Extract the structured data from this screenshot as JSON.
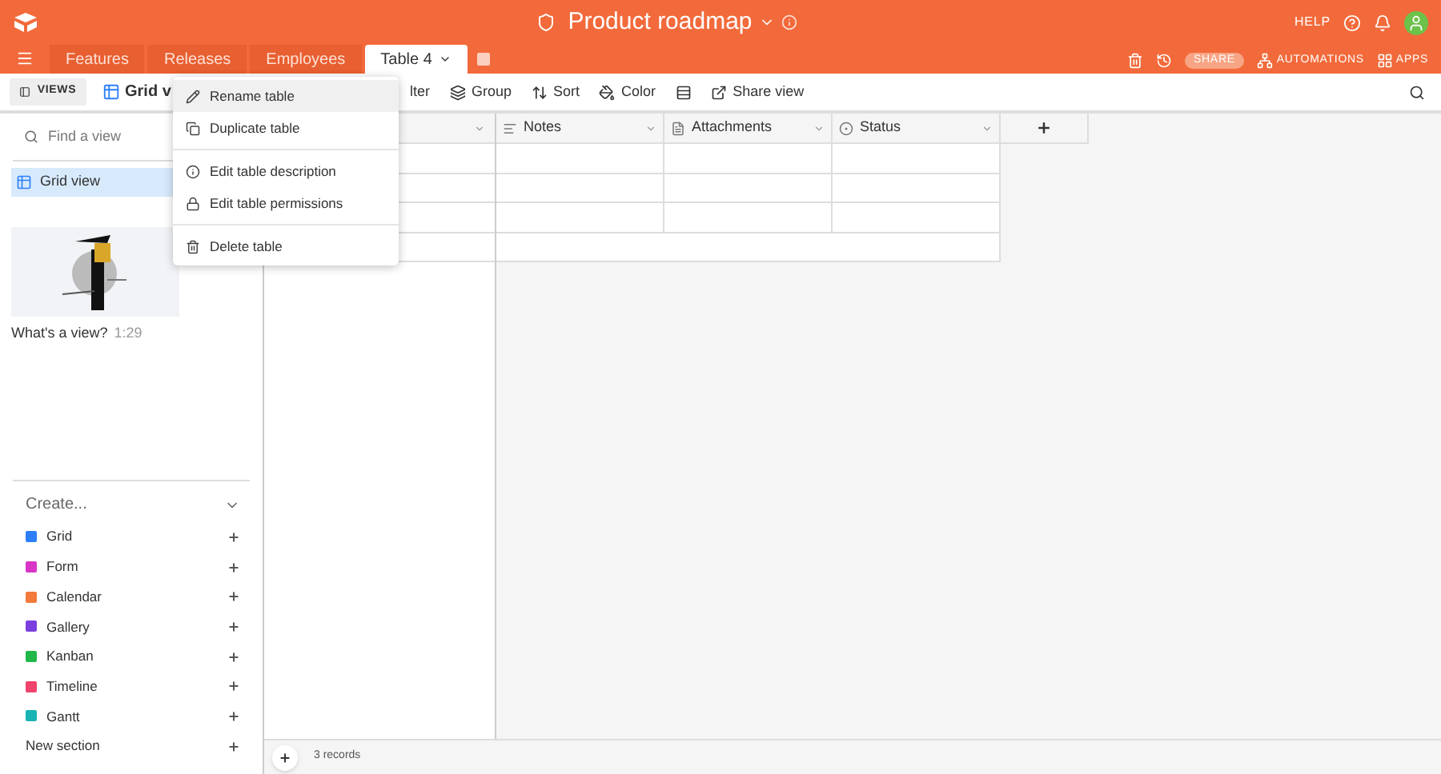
{
  "header": {
    "title": "Product roadmap",
    "help": "HELP"
  },
  "tabs": [
    {
      "label": "Features",
      "selected": false
    },
    {
      "label": "Releases",
      "selected": false
    },
    {
      "label": "Employees",
      "selected": false
    },
    {
      "label": "Table 4",
      "selected": true
    }
  ],
  "tab_actions": {
    "share": "SHARE",
    "automations": "AUTOMATIONS",
    "apps": "APPS"
  },
  "toolbar": {
    "views": "VIEWS",
    "current_view": "Grid v",
    "items": [
      "lter",
      "Group",
      "Sort",
      "Color",
      "Share view"
    ]
  },
  "menu": [
    {
      "label": "Rename table",
      "selected": true
    },
    {
      "label": "Duplicate table",
      "selected": false
    },
    {
      "label": "Edit table description",
      "selected": false
    },
    {
      "label": "Edit table permissions",
      "selected": false
    },
    {
      "label": "Delete table",
      "selected": false
    }
  ],
  "sidebar": {
    "search_placeholder": "Find a view",
    "views": [
      {
        "label": "Grid view",
        "selected": true
      }
    ],
    "video": {
      "caption": "What's a view?",
      "duration": "1:29"
    },
    "create": {
      "label": "Create...",
      "items": [
        {
          "label": "Grid",
          "color": "#2d7ff9"
        },
        {
          "label": "Form",
          "color": "#d936c8"
        },
        {
          "label": "Calendar",
          "color": "#f27a3a"
        },
        {
          "label": "Gallery",
          "color": "#7b3fe0"
        },
        {
          "label": "Kanban",
          "color": "#20b848"
        },
        {
          "label": "Timeline",
          "color": "#f0436b"
        },
        {
          "label": "Gantt",
          "color": "#19b3b3"
        },
        {
          "label": "New section"
        }
      ]
    }
  },
  "table": {
    "columns": [
      {
        "label": "Notes"
      },
      {
        "label": "Attachments"
      },
      {
        "label": "Status"
      }
    ],
    "footer": "3 records"
  }
}
